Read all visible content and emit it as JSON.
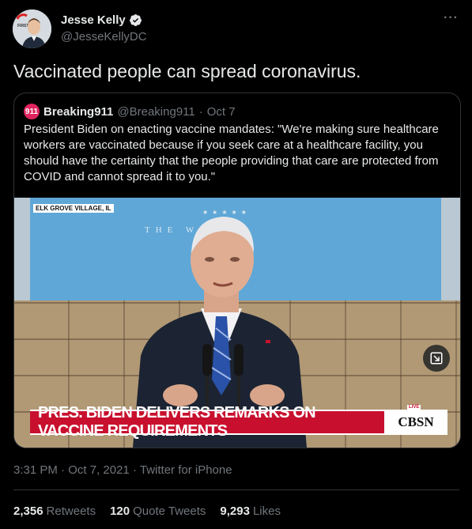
{
  "author": {
    "name": "Jesse Kelly",
    "handle": "@JesseKellyDC",
    "avatar_badge_text": "FIRST"
  },
  "tweet": {
    "text": "Vaccinated people can spread coronavirus."
  },
  "quoted": {
    "avatar_text": "911",
    "name": "Breaking911",
    "handle": "@Breaking911",
    "separator": "·",
    "date": "Oct 7",
    "text": "President Biden on enacting vaccine mandates: \"We're making sure healthcare workers are vaccinated because if you seek care at a healthcare facility, you should have the certainty that the people providing that care are protected from COVID and cannot spread it to you.\"",
    "media": {
      "location_tag": "ELK GROVE VILLAGE, IL",
      "backdrop_text": "THE W    USE",
      "lower_third": "PRES. BIDEN DELIVERS REMARKS ON VACCINE REQUIREMENTS",
      "network_logo": "CBSN",
      "live_tag": "LIVE",
      "expand_icon": "expand-icon"
    }
  },
  "meta": {
    "time": "3:31 PM",
    "separator": "·",
    "date": "Oct 7, 2021",
    "source": "Twitter for iPhone"
  },
  "stats": [
    {
      "value": "2,356",
      "label": "Retweets"
    },
    {
      "value": "120",
      "label": "Quote Tweets"
    },
    {
      "value": "9,293",
      "label": "Likes"
    }
  ],
  "colors": {
    "background": "#000000",
    "text": "#e7e9ea",
    "secondary": "#71767b",
    "border": "#2f3336",
    "verified": "#1d9bf0",
    "lower_third": "#c8102e"
  }
}
